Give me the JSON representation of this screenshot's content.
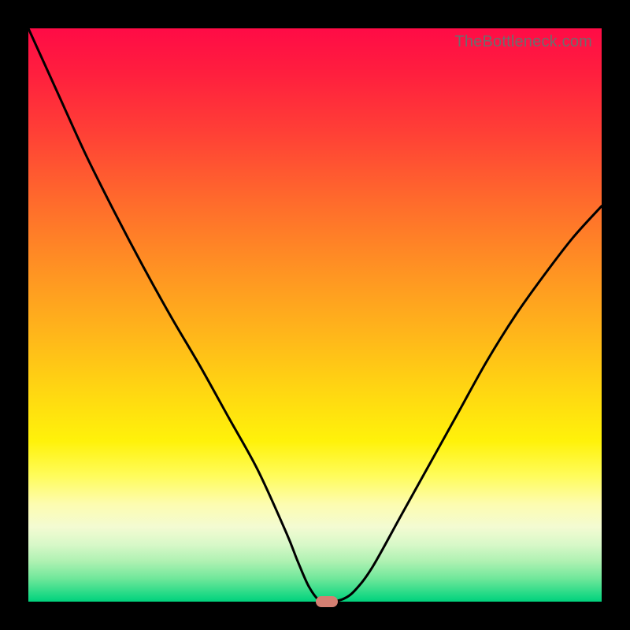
{
  "watermark": "TheBottleneck.com",
  "colors": {
    "frame": "#000000",
    "curve_stroke": "#000000",
    "marker": "#d47f72",
    "watermark_text": "#6d6d6d",
    "gradient_top": "#ff0b46",
    "gradient_bottom": "#00d07c"
  },
  "chart_data": {
    "type": "line",
    "title": "",
    "xlabel": "",
    "ylabel": "",
    "xlim": [
      0,
      100
    ],
    "ylim": [
      0,
      100
    ],
    "grid": false,
    "legend": false,
    "series": [
      {
        "name": "bottleneck-curve",
        "x": [
          0,
          5,
          10,
          15,
          20,
          25,
          30,
          35,
          40,
          45,
          47,
          49,
          51,
          53,
          55,
          57,
          60,
          65,
          70,
          75,
          80,
          85,
          90,
          95,
          100
        ],
        "y": [
          100,
          89,
          78,
          68,
          58.5,
          49.5,
          41,
          32,
          23,
          12,
          7,
          2.5,
          0,
          0,
          0.5,
          2,
          6,
          15,
          24,
          33,
          42,
          50,
          57,
          63.5,
          69
        ]
      }
    ],
    "marker": {
      "x": 52,
      "y": 0,
      "label": ""
    },
    "annotations": []
  }
}
